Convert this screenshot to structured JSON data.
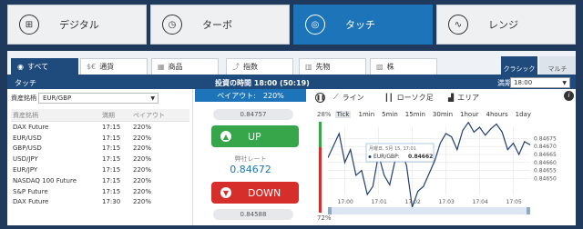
{
  "top_tabs": [
    {
      "label": "デジタル",
      "icon": "dial-icon"
    },
    {
      "label": "ターボ",
      "icon": "clock-icon"
    },
    {
      "label": "タッチ",
      "icon": "target-icon",
      "active": true
    },
    {
      "label": "レンジ",
      "icon": "range-icon"
    }
  ],
  "sub_tabs": [
    {
      "label": "すべて",
      "icon": "globe-icon",
      "active": true
    },
    {
      "label": "通貨",
      "icon": "currency-icon"
    },
    {
      "label": "商品",
      "icon": "commodity-icon"
    },
    {
      "label": "指数",
      "icon": "index-icon"
    },
    {
      "label": "先物",
      "icon": "futures-icon"
    },
    {
      "label": "株",
      "icon": "stock-icon"
    }
  ],
  "view_buttons": {
    "classic": "クラシック",
    "multi": "マルチ"
  },
  "header": {
    "title": "タッチ",
    "investment_time": "投資の時間 18:00 (50:19)",
    "expiry_label": "満期",
    "expiry_value": "18:00"
  },
  "asset_selector": {
    "label": "資産銘柄",
    "value": "EUR/GBP"
  },
  "asset_table": {
    "columns": [
      "資産銘柄",
      "満期",
      "ペイアウト"
    ],
    "rows": [
      [
        "DAX Future",
        "17:15",
        "220%"
      ],
      [
        "EUR/USD",
        "17:15",
        "220%"
      ],
      [
        "GBP/USD",
        "17:15",
        "220%"
      ],
      [
        "USD/JPY",
        "17:15",
        "220%"
      ],
      [
        "EUR/JPY",
        "17:15",
        "220%"
      ],
      [
        "NASDAQ 100 Future",
        "17:15",
        "220%"
      ],
      [
        "S&P Future",
        "17:15",
        "220%"
      ],
      [
        "DAX Future",
        "17:30",
        "220%"
      ]
    ]
  },
  "trade": {
    "payout": "ペイアウト:　220%",
    "up_price": "0.84757",
    "up_label": "UP",
    "rate_label": "弊社レート",
    "rate_value": "0.84672",
    "down_label": "DOWN",
    "down_price": "0.84588"
  },
  "chart_toolbar": {
    "line": "ライン",
    "candle": "ローソク足",
    "area": "エリア"
  },
  "timeframes": [
    "Tick",
    "1min",
    "5min",
    "15min",
    "30min",
    "1hour",
    "4hours",
    "1day"
  ],
  "sentiment": {
    "top": "28%",
    "bottom": "72%",
    "top_value": 28,
    "bottom_value": 72
  },
  "tooltip": {
    "date": "月曜日, 5月 15, 17:01",
    "pair": "EUR/GBP:",
    "value": "0.84662"
  },
  "colors": {
    "primary": "#1e74b8",
    "navy": "#1e4a7c",
    "up": "#37a64a",
    "down": "#d62e2b",
    "bg": "#1f3a5c"
  },
  "chart_data": {
    "type": "line",
    "series": [
      {
        "name": "EUR/GBP",
        "values": [
          [
            "16:59:30",
            0.84663
          ],
          [
            "16:59:50",
            0.84678
          ],
          [
            "17:00:00",
            0.8466
          ],
          [
            "17:00:10",
            0.84668
          ],
          [
            "17:00:20",
            0.84652
          ],
          [
            "17:00:30",
            0.84655
          ],
          [
            "17:00:40",
            0.8464
          ],
          [
            "17:00:50",
            0.84645
          ],
          [
            "17:01:00",
            0.84665
          ],
          [
            "17:01:10",
            0.84652
          ],
          [
            "17:01:20",
            0.84646
          ],
          [
            "17:01:30",
            0.84662
          ],
          [
            "17:01:40",
            0.84668
          ],
          [
            "17:01:50",
            0.84658
          ],
          [
            "17:02:00",
            0.84632
          ],
          [
            "17:02:10",
            0.84642
          ],
          [
            "17:02:20",
            0.84645
          ],
          [
            "17:02:30",
            0.84653
          ],
          [
            "17:02:40",
            0.84661
          ],
          [
            "17:02:50",
            0.84672
          ],
          [
            "17:03:00",
            0.84678
          ],
          [
            "17:03:10",
            0.84676
          ],
          [
            "17:03:20",
            0.84668
          ],
          [
            "17:03:30",
            0.8468
          ],
          [
            "17:03:40",
            0.84685
          ],
          [
            "17:03:50",
            0.84679
          ],
          [
            "17:04:00",
            0.84682
          ],
          [
            "17:04:10",
            0.84677
          ],
          [
            "17:04:20",
            0.84681
          ],
          [
            "17:04:30",
            0.84684
          ],
          [
            "17:04:40",
            0.84679
          ],
          [
            "17:04:50",
            0.84668
          ],
          [
            "17:05:00",
            0.84672
          ],
          [
            "17:05:10",
            0.84665
          ],
          [
            "17:05:20",
            0.84673
          ],
          [
            "17:05:30",
            0.84671
          ]
        ]
      }
    ],
    "x_ticks": [
      "17:00",
      "17:01",
      "17:02",
      "17:03",
      "17:04",
      "17:05"
    ],
    "y_ticks": [
      "0.84675",
      "0.84670",
      "0.84665",
      "0.84660",
      "0.84655",
      "0.84650"
    ],
    "ylim": [
      0.8464,
      0.84682
    ],
    "grid": true
  }
}
